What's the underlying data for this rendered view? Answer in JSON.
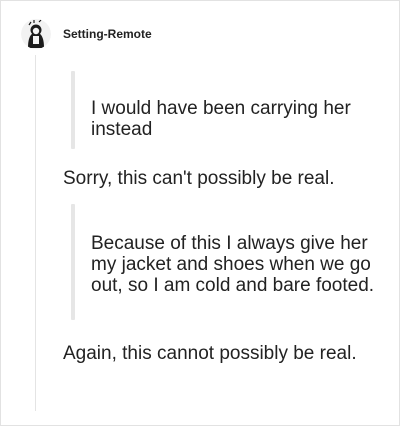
{
  "post": {
    "username": "Setting-Remote",
    "avatar_icon": "user-avatar-icon",
    "blocks": [
      {
        "type": "quote",
        "text": "I would have been carrying her instead"
      },
      {
        "type": "reply",
        "text": "Sorry, this can't possibly be real."
      },
      {
        "type": "quote",
        "text": "Because of this I always give her my jacket and shoes when we go out, so I am cold and bare footed."
      },
      {
        "type": "reply",
        "text": "Again, this cannot possibly be real."
      }
    ]
  },
  "colors": {
    "quote_bar": "#e6e6e6",
    "thread_line": "#e4e4e4",
    "text": "#222222"
  }
}
